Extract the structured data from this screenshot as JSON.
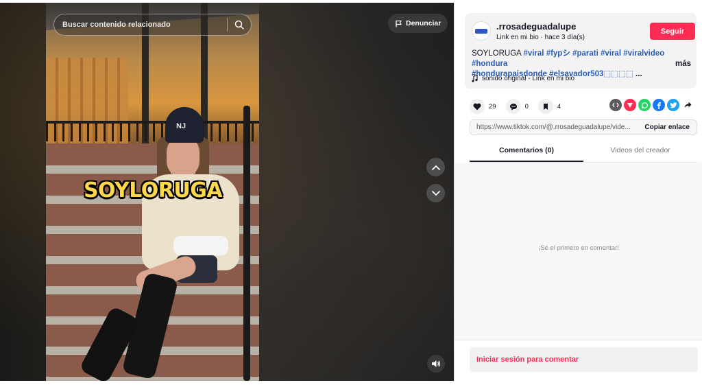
{
  "video": {
    "overlay_text": "SOYLORUGA",
    "hat_logo": "NJ",
    "search_placeholder": "Buscar contenido relacionado",
    "report_label": "Denunciar"
  },
  "author": {
    "username": ".rrosadeguadalupe",
    "subline": "Link en mi bio · hace 3 día(s)",
    "follow_label": "Seguir"
  },
  "description": {
    "text_prefix": "SOYLORUGA ",
    "tags": [
      "#viral",
      "#fypシ",
      "#parati",
      "#viral",
      "#viralvideo",
      "#hondura",
      "#hondurapaisdonde",
      "#elsavador503⬚⬚⬚⬚"
    ],
    "ellipsis": " ...",
    "more_label": "más",
    "sound": "sonido original - Link en mi bio"
  },
  "stats": {
    "likes": "29",
    "comments": "0",
    "saves": "4"
  },
  "share": {
    "url": "https://www.tiktok.com/@.rrosadeguadalupe/vide...",
    "copy_label": "Copiar enlace"
  },
  "tabs": [
    {
      "label": "Comentarios (0)",
      "active": true
    },
    {
      "label": "Videos del creador",
      "active": false
    }
  ],
  "comments": {
    "empty_text": "¡Sé el primero en comentar!",
    "login_label": "Iniciar sesión para comentar"
  },
  "colors": {
    "brand": "#fe2c55",
    "hashtag": "#2b5db9",
    "overlay_text": "#ffd84a"
  },
  "icons": [
    "search-icon",
    "flag-icon",
    "chevron-up-icon",
    "chevron-down-icon",
    "volume-icon",
    "heart-icon",
    "comment-icon",
    "bookmark-icon",
    "embed-icon",
    "send-icon",
    "whatsapp-icon",
    "facebook-icon",
    "twitter-icon",
    "share-arrow-icon",
    "music-note-icon"
  ]
}
